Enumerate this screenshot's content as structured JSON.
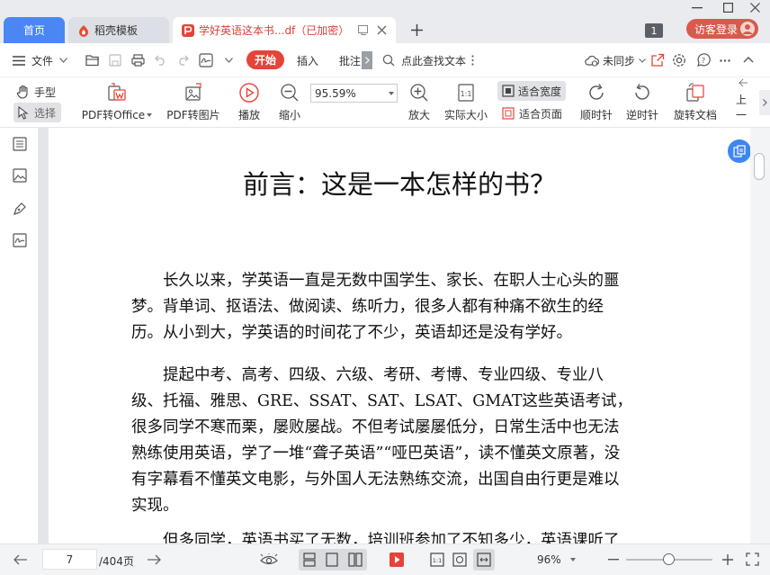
{
  "tabs": {
    "home": "首页",
    "templates": "稻壳模板",
    "document": "学好英语这本书...df（已加密）"
  },
  "titlebar": {
    "badge": "1",
    "login": "访客登录"
  },
  "toolbar": {
    "file": "文件",
    "start": "开始",
    "insert": "插入",
    "annotate": "批注",
    "search": "点此查找文本",
    "sync": "未同步"
  },
  "ribbon": {
    "hand": "手型",
    "select": "选择",
    "pdf_to_office": "PDF转Office",
    "pdf_to_image": "PDF转图片",
    "play": "播放",
    "zoom_out": "缩小",
    "zoom_value": "95.59%",
    "zoom_in": "放大",
    "actual_size": "实际大小",
    "fit_width": "适合宽度",
    "fit_page": "适合页面",
    "rotate_cw": "顺时针",
    "rotate_ccw": "逆时针",
    "rotate_doc": "旋转文档",
    "prev": "上一"
  },
  "document": {
    "title": "前言：这是一本怎样的书？",
    "para1": [
      "长久以来，学英语一直是无数中国学生、家长、在职人士心头的噩",
      "梦。背单词、抠语法、做阅读、练听力，很多人都有种痛不欲生的经",
      "历。从小到大，学英语的时间花了不少，英语却还是没有学好。"
    ],
    "para2": [
      "提起中考、高考、四级、六级、考研、考博、专业四级、专业八",
      "级、托福、雅思、GRE、SSAT、SAT、LSAT、GMAT这些英语考试，",
      "很多同学不寒而栗，屡败屡战。不但考试屡屡低分，日常生活中也无法",
      "熟练使用英语，学了一堆“聋子英语”“哑巴英语”，读不懂英文原著，没",
      "有字幕看不懂英文电影，与外国人无法熟练交流，出国自由行更是难以",
      "实现。"
    ],
    "para3_partial": "但多同学，英语书买了无数，培训班参加了不知多少，英语课听了"
  },
  "status": {
    "page": "7",
    "total": "/404页",
    "zoom": "96%"
  },
  "colors": {
    "accent_blue": "#4a87f5",
    "start_red": "#e5443b",
    "tab_text_red": "#d9413a",
    "login_red": "#d95a4c"
  }
}
